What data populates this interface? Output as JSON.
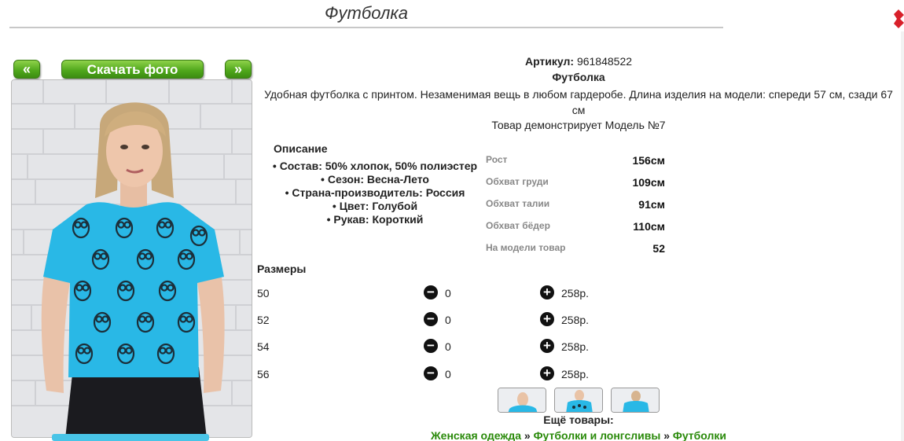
{
  "header": {
    "title": "Футболка"
  },
  "gallery": {
    "prev_label": "«",
    "next_label": "»",
    "download_label": "Скачать фото"
  },
  "product": {
    "sku_label": "Артикул:",
    "sku_value": "961848522",
    "name": "Футболка",
    "description": "Удобная футболка с принтом. Незаменимая вещь в любом гардеробе. Длина изделия на модели: спереди 57 см, сзади 67 см",
    "model_note": "Товар демонстрирует Модель №7"
  },
  "details": {
    "title": "Описание",
    "items": [
      "Состав: 50% хлопок, 50% полиэстер",
      "Сезон: Весна-Лето",
      "Страна-производитель: Россия",
      "Цвет: Голубой",
      "Рукав: Короткий"
    ]
  },
  "measurements": [
    {
      "label": "Рост",
      "value": "156см"
    },
    {
      "label": "Обхват груди",
      "value": "109см"
    },
    {
      "label": "Обхват талии",
      "value": "91см"
    },
    {
      "label": "Обхват бёдер",
      "value": "110см"
    },
    {
      "label": "На модели товар",
      "value": "52"
    }
  ],
  "sizes": {
    "title": "Размеры",
    "rows": [
      {
        "size": "50",
        "qty": "0",
        "price": "258р."
      },
      {
        "size": "52",
        "qty": "0",
        "price": "258р."
      },
      {
        "size": "54",
        "qty": "0",
        "price": "258р."
      },
      {
        "size": "56",
        "qty": "0",
        "price": "258р."
      }
    ]
  },
  "more": {
    "title": "Ещё товары:",
    "breadcrumbs": [
      "Женская одежда",
      "Футболки и лонгсливы",
      "Футболки"
    ],
    "separator": "»"
  },
  "icons": {
    "minus": "minus-circle-icon",
    "plus": "plus-circle-icon",
    "close": "close-icon"
  },
  "colors": {
    "accent_green": "#4ea61a",
    "link_green": "#2a8a0a",
    "shirt_blue": "#29b8e6",
    "close_red": "#d8202a"
  }
}
